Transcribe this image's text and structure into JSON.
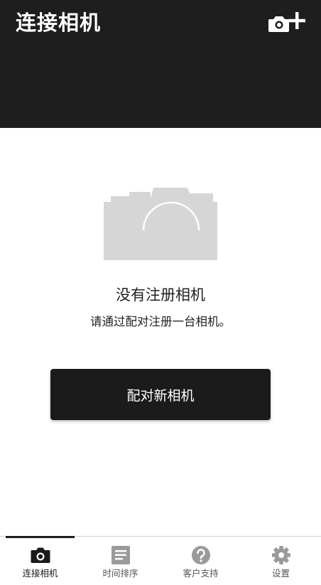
{
  "header": {
    "title": "连接相机",
    "add_camera_icon": "camera-add-icon"
  },
  "empty_state": {
    "illustration_icon": "camera-icon",
    "title": "没有注册相机",
    "subtitle": "请通过配对注册一台相机。"
  },
  "pair_button": {
    "label": "配对新相机"
  },
  "bottom_nav": {
    "items": [
      {
        "label": "连接相机",
        "icon": "camera-icon",
        "active": true
      },
      {
        "label": "时间排序",
        "icon": "list-icon",
        "active": false
      },
      {
        "label": "客户支持",
        "icon": "help-icon",
        "active": false
      },
      {
        "label": "设置",
        "icon": "gear-icon",
        "active": false
      }
    ]
  },
  "colors": {
    "header_bg": "#1e1e1e",
    "button_bg": "#1b1b1b",
    "illustration": "#d6d6d6",
    "nav_inactive_icon": "#9a9a9a"
  }
}
